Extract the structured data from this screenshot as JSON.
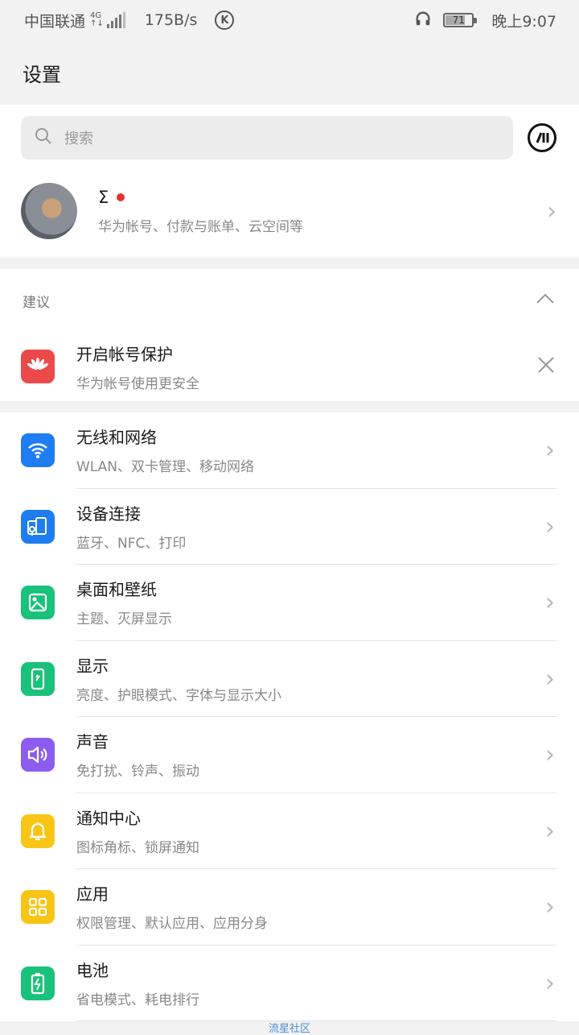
{
  "status_bar": {
    "carrier": "中国联通",
    "net": "4G",
    "speed": "175B/s",
    "k_label": "K",
    "battery": "71",
    "time": "晚上9:07"
  },
  "header": {
    "title": "设置"
  },
  "search": {
    "placeholder": "搜索"
  },
  "account": {
    "name": "Σ",
    "subtitle": "华为帐号、付款与账单、云空间等"
  },
  "suggest": {
    "label": "建议",
    "item": {
      "title": "开启帐号保护",
      "subtitle": "华为帐号使用更安全"
    }
  },
  "menu": [
    {
      "title": "无线和网络",
      "subtitle": "WLAN、双卡管理、移动网络",
      "color": "#1e7df0",
      "icon": "wifi-icon"
    },
    {
      "title": "设备连接",
      "subtitle": "蓝牙、NFC、打印",
      "color": "#1e7df0",
      "icon": "device-connect-icon"
    },
    {
      "title": "桌面和壁纸",
      "subtitle": "主题、灭屏显示",
      "color": "#19c27a",
      "icon": "wallpaper-icon"
    },
    {
      "title": "显示",
      "subtitle": "亮度、护眼模式、字体与显示大小",
      "color": "#19c27a",
      "icon": "display-icon"
    },
    {
      "title": "声音",
      "subtitle": "免打扰、铃声、振动",
      "color": "#8c5cf0",
      "icon": "sound-icon"
    },
    {
      "title": "通知中心",
      "subtitle": "图标角标、锁屏通知",
      "color": "#f8c516",
      "icon": "bell-icon"
    },
    {
      "title": "应用",
      "subtitle": "权限管理、默认应用、应用分身",
      "color": "#f8c516",
      "icon": "apps-icon"
    },
    {
      "title": "电池",
      "subtitle": "省电模式、耗电排行",
      "color": "#19c27a",
      "icon": "battery-icon"
    }
  ],
  "watermark": "流星社区"
}
